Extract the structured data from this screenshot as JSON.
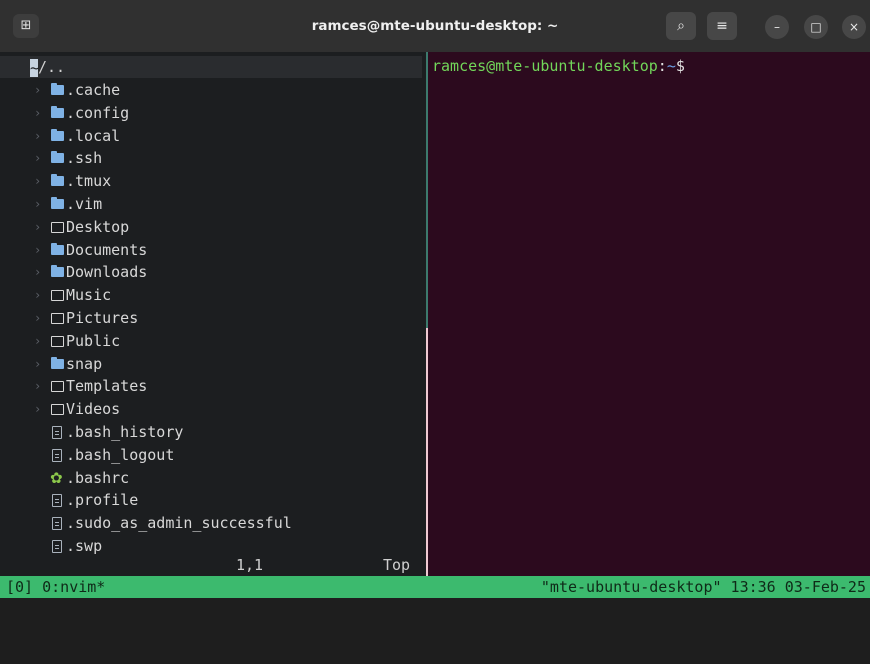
{
  "titlebar": {
    "title": "ramces@mte-ubuntu-desktop: ~",
    "new_tab_icon": "⊞",
    "search_icon": "⌕",
    "menu_icon": "≡",
    "minimize_icon": "–",
    "maximize_icon": "□",
    "close_icon": "×"
  },
  "tree": {
    "header": "/..",
    "items": [
      {
        "name": ".cache",
        "type": "folder-solid",
        "expandable": true
      },
      {
        "name": ".config",
        "type": "folder-solid",
        "expandable": true
      },
      {
        "name": ".local",
        "type": "folder-solid",
        "expandable": true
      },
      {
        "name": ".ssh",
        "type": "folder-solid",
        "expandable": true
      },
      {
        "name": ".tmux",
        "type": "folder-solid",
        "expandable": true
      },
      {
        "name": ".vim",
        "type": "folder-solid",
        "expandable": true
      },
      {
        "name": "Desktop",
        "type": "folder-open",
        "expandable": true
      },
      {
        "name": "Documents",
        "type": "folder-solid",
        "expandable": true
      },
      {
        "name": "Downloads",
        "type": "folder-solid",
        "expandable": true
      },
      {
        "name": "Music",
        "type": "folder-open",
        "expandable": true
      },
      {
        "name": "Pictures",
        "type": "folder-open",
        "expandable": true
      },
      {
        "name": "Public",
        "type": "folder-open",
        "expandable": true
      },
      {
        "name": "snap",
        "type": "folder-solid",
        "expandable": true
      },
      {
        "name": "Templates",
        "type": "folder-open",
        "expandable": true
      },
      {
        "name": "Videos",
        "type": "folder-open",
        "expandable": true
      },
      {
        "name": ".bash_history",
        "type": "file",
        "expandable": false
      },
      {
        "name": ".bash_logout",
        "type": "file",
        "expandable": false
      },
      {
        "name": ".bashrc",
        "type": "gear",
        "expandable": false
      },
      {
        "name": ".profile",
        "type": "file",
        "expandable": false
      },
      {
        "name": ".sudo_as_admin_successful",
        "type": "file",
        "expandable": false
      },
      {
        "name": ".swp",
        "type": "file",
        "expandable": false
      }
    ],
    "position": "1,1",
    "scroll": "Top"
  },
  "shell": {
    "user_host": "ramces@mte-ubuntu-desktop",
    "colon": ":",
    "path": "~",
    "dollar": "$"
  },
  "status": {
    "left": "[0] 0:nvim*",
    "right": "\"mte-ubuntu-desktop\" 13:36 03-Feb-25"
  },
  "colors": {
    "status_bg": "#3cba6e",
    "shell_bg": "#2c0a1e",
    "folder_blue": "#7fb2e5",
    "prompt_user": "#72d65a",
    "prompt_path": "#6da0e6"
  }
}
